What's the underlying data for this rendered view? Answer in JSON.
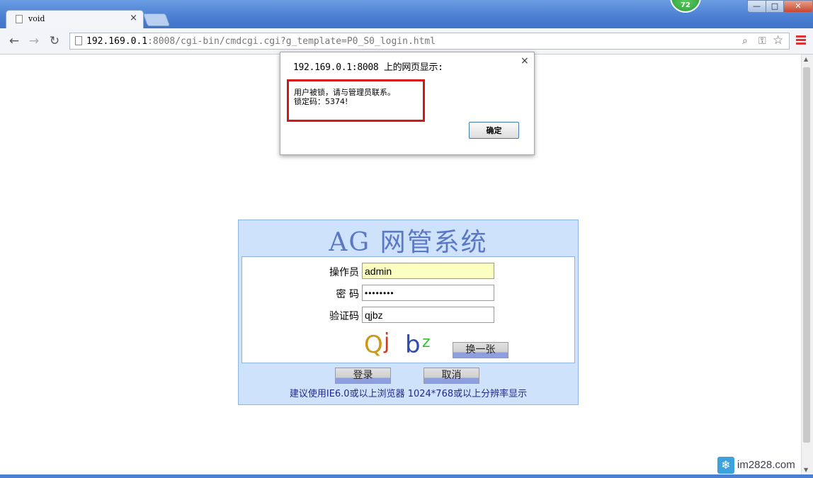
{
  "browser": {
    "tab_title": "void",
    "tab_close": "×",
    "badge": "72",
    "window_controls": {
      "minimize": "—",
      "maximize": "□",
      "close": "✕"
    },
    "nav": {
      "back": "←",
      "forward": "→",
      "reload": "↻"
    },
    "url": {
      "host": "192.169.0.1",
      "rest": ":8008/cgi-bin/cmdcgi.cgi?g_template=P0_S0_login.html"
    },
    "icons": {
      "zoom": "search-icon",
      "key": "key-icon",
      "star": "star-icon",
      "menu": "menu-icon"
    }
  },
  "alert": {
    "title": "192.169.0.1:8008 上的网页显示:",
    "close": "×",
    "message_line1": "用户被锁，请与管理员联系。",
    "message_line2": "锁定码：5374!",
    "ok_label": "确定",
    "highlight_color": "#d61717"
  },
  "login": {
    "title": "AG 网管系统",
    "operator_label": "操作员",
    "operator_value": "admin",
    "password_label": "密 码",
    "password_value": "••••••••",
    "captcha_label": "验证码",
    "captcha_value": "qjbz",
    "captcha_image": {
      "chars": [
        "Q",
        "j",
        "b",
        "z"
      ],
      "colors": [
        "#c99a16",
        "#d9341c",
        "#2d4bb0",
        "#37c236"
      ]
    },
    "refresh_label": "换一张",
    "login_label": "登录",
    "cancel_label": "取消",
    "hint": "建议使用IE6.0或以上浏览器 1024*768或以上分辨率显示"
  },
  "watermark": {
    "text": "im2828.com",
    "icon": "snowflake-icon"
  }
}
